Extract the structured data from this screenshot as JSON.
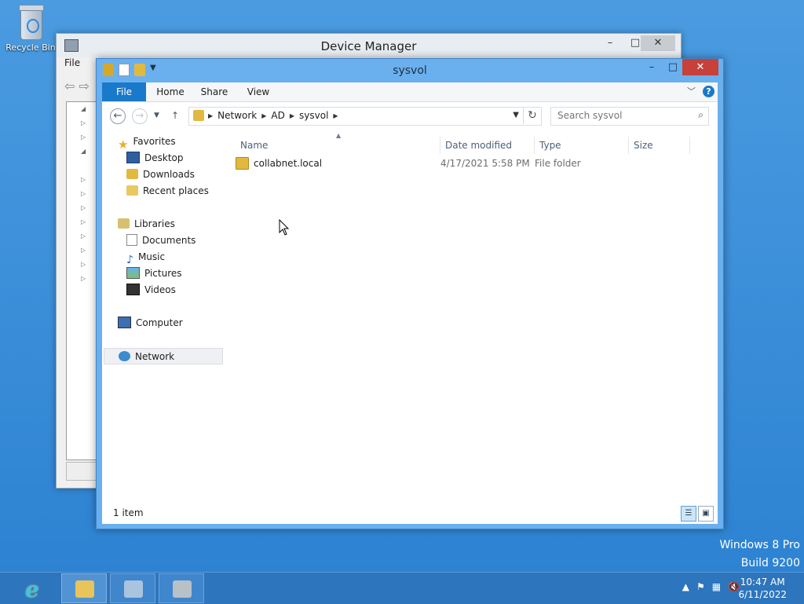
{
  "desktop": {
    "recycle_bin_label": "Recycle Bin",
    "watermark": {
      "line1": "Windows 8 Pro",
      "line2": "Build 9200"
    }
  },
  "device_manager": {
    "title": "Device Manager",
    "menu_file": "File",
    "controls": {
      "minimize": "–",
      "maximize": "□",
      "close": "✕"
    }
  },
  "explorer": {
    "title": "sysvol",
    "controls": {
      "minimize": "–",
      "maximize": "□",
      "close": "✕"
    },
    "ribbon": {
      "tabs": [
        "File",
        "Home",
        "Share",
        "View"
      ],
      "help": "?"
    },
    "address": {
      "crumbs": [
        "Network",
        "AD",
        "sysvol"
      ]
    },
    "search": {
      "placeholder": "Search sysvol"
    },
    "nav": {
      "favorites": "Favorites",
      "favorites_items": [
        "Desktop",
        "Downloads",
        "Recent places"
      ],
      "libraries": "Libraries",
      "libraries_items": [
        "Documents",
        "Music",
        "Pictures",
        "Videos"
      ],
      "computer": "Computer",
      "network": "Network"
    },
    "columns": [
      "Name",
      "Date modified",
      "Type",
      "Size"
    ],
    "files": [
      {
        "name": "collabnet.local",
        "date": "4/17/2021 5:58 PM",
        "type": "File folder",
        "size": ""
      }
    ],
    "status": "1 item"
  },
  "taskbar": {
    "clock_time": "10:47 AM",
    "clock_date": "6/11/2022"
  },
  "colors": {
    "desktop_blue": "#3c8fd6",
    "accent_blue": "#1979ca",
    "close_red": "#c7403a"
  }
}
